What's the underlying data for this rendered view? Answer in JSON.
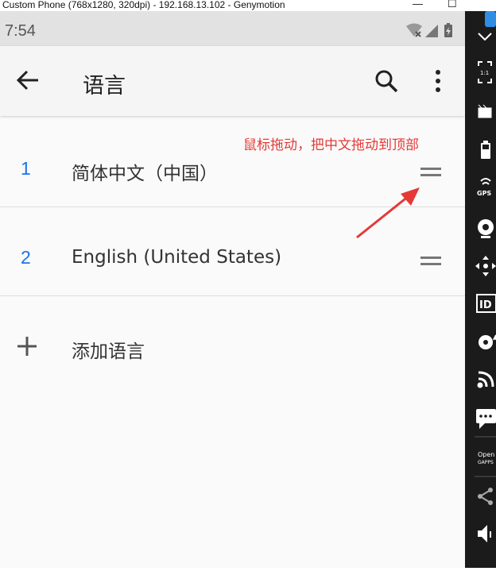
{
  "window": {
    "title": "Custom Phone (768x1280, 320dpi) - 192.168.13.102 - Genymotion",
    "minimize": "—",
    "maximize": "☐"
  },
  "status_bar": {
    "time": "7:54"
  },
  "app_bar": {
    "title": "语言"
  },
  "languages": [
    {
      "index": "1",
      "name": "简体中文（中国）"
    },
    {
      "index": "2",
      "name": "English (United States)"
    }
  ],
  "add_language": {
    "label": "添加语言"
  },
  "annotation": {
    "text": "鼠标拖动，把中文拖动到顶部",
    "color": "#e53935"
  },
  "sidebar": {
    "items": [
      {
        "icon": "link-icon"
      },
      {
        "icon": "pixel-perfect-icon",
        "label": "1:1"
      },
      {
        "icon": "screen-record-icon"
      },
      {
        "icon": "battery-icon"
      },
      {
        "icon": "gps-icon",
        "label": "GPS"
      },
      {
        "icon": "camera-icon"
      },
      {
        "icon": "dpad-icon"
      },
      {
        "icon": "device-id-icon",
        "label": "ID"
      },
      {
        "icon": "disk-io-icon"
      },
      {
        "icon": "network-icon"
      },
      {
        "icon": "sms-icon"
      },
      {
        "icon": "open-gapps-icon",
        "label": "Open GAPPS"
      },
      {
        "icon": "share-icon"
      },
      {
        "icon": "volume-icon"
      }
    ]
  },
  "colors": {
    "accent": "#1a73e8",
    "annotation": "#e53935"
  }
}
